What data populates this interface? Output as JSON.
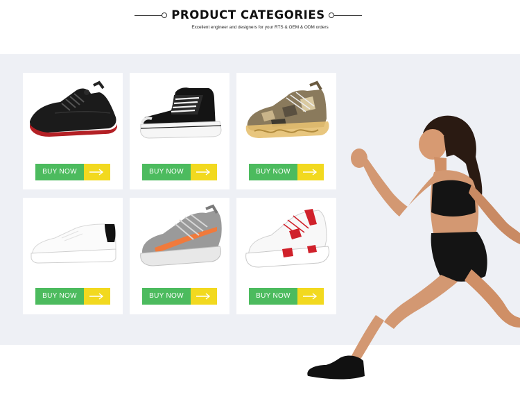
{
  "header": {
    "title": "PRODUCT CATEGORIES",
    "subtitle": "Excelient engineer and designers for your RTS & OEM & ODM orders"
  },
  "products": [
    {
      "kind": "black-knit-sneaker",
      "buy_label": "BUY NOW",
      "arrow_icon": "arrow-right-icon"
    },
    {
      "kind": "black-canvas-high-top",
      "buy_label": "BUY NOW",
      "arrow_icon": "arrow-right-icon"
    },
    {
      "kind": "camo-running-shoe",
      "buy_label": "BUY NOW",
      "arrow_icon": "arrow-right-icon"
    },
    {
      "kind": "white-leather-sneaker",
      "buy_label": "BUY NOW",
      "arrow_icon": "arrow-right-icon"
    },
    {
      "kind": "grey-orange-knit-sneaker",
      "buy_label": "BUY NOW",
      "arrow_icon": "arrow-right-icon"
    },
    {
      "kind": "white-red-sneaker",
      "buy_label": "BUY NOW",
      "arrow_icon": "arrow-right-icon"
    }
  ],
  "colors": {
    "buy_green": "#4cbb5e",
    "arrow_yellow": "#f2d91f",
    "band_background": "#eef0f5"
  }
}
